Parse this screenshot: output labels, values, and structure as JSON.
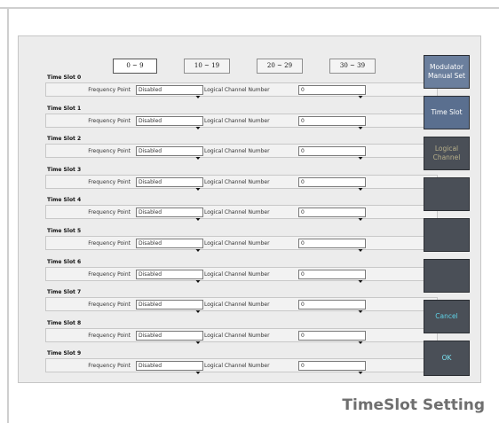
{
  "tabs": [
    "0 ~ 9",
    "10 ~ 19",
    "20 ~ 29",
    "30 ~ 39"
  ],
  "row_labels": {
    "frequency_point": "Frequency Point",
    "logical_channel_number": "Logical Channel Number"
  },
  "slots": [
    {
      "title": "Time Slot 0",
      "frequency_point": "Disabled",
      "logical_channel": "0"
    },
    {
      "title": "Time Slot 1",
      "frequency_point": "Disabled",
      "logical_channel": "0"
    },
    {
      "title": "Time Slot 2",
      "frequency_point": "Disabled",
      "logical_channel": "0"
    },
    {
      "title": "Time Slot 3",
      "frequency_point": "Disabled",
      "logical_channel": "0"
    },
    {
      "title": "Time Slot 4",
      "frequency_point": "Disabled",
      "logical_channel": "0"
    },
    {
      "title": "Time Slot 5",
      "frequency_point": "Disabled",
      "logical_channel": "0"
    },
    {
      "title": "Time Slot 6",
      "frequency_point": "Disabled",
      "logical_channel": "0"
    },
    {
      "title": "Time Slot 7",
      "frequency_point": "Disabled",
      "logical_channel": "0"
    },
    {
      "title": "Time Slot 8",
      "frequency_point": "Disabled",
      "logical_channel": "0"
    },
    {
      "title": "Time Slot 9",
      "frequency_point": "Disabled",
      "logical_channel": "0"
    }
  ],
  "side_buttons": {
    "modulator_line1": "Modulator",
    "modulator_line2": "Manual Set",
    "time_slot": "Time Slot",
    "logical_line1": "Logical",
    "logical_line2": "Channel",
    "cancel": "Cancel",
    "ok": "OK"
  },
  "caption": "TimeSlot Setting",
  "colors": {
    "accent": "#5a6f8f",
    "sidebar": "#4a4f57",
    "cancel_text": "#5fd3e8"
  }
}
